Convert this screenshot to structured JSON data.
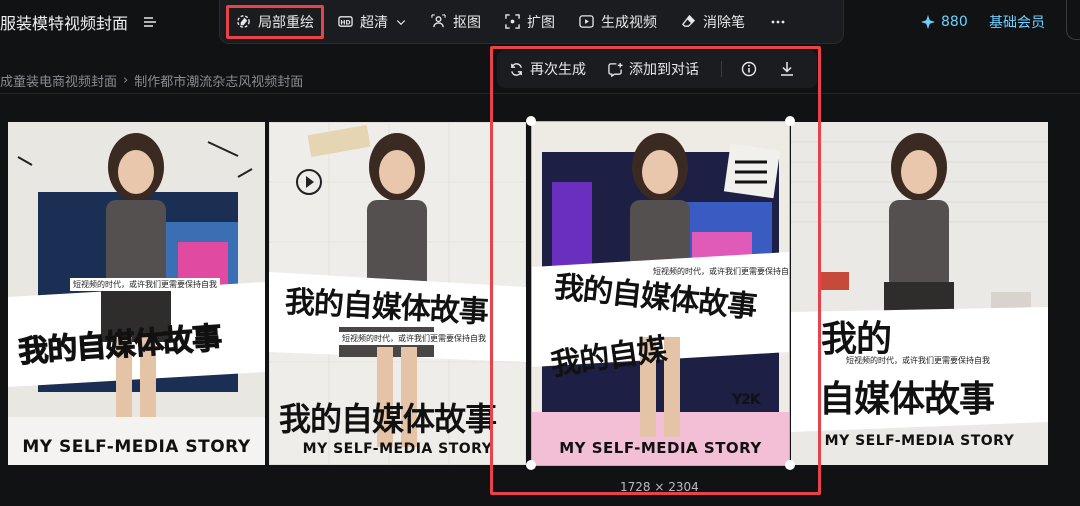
{
  "header": {
    "title": "服装模特视频封面",
    "credits": "880",
    "member": "基础会员"
  },
  "toolbar": {
    "items": [
      {
        "label": "局部重绘",
        "icon": "inpaint-brush-icon"
      },
      {
        "label": "超清",
        "icon": "hd-icon"
      },
      {
        "label": "抠图",
        "icon": "cutout-person-icon"
      },
      {
        "label": "扩图",
        "icon": "expand-icon"
      },
      {
        "label": "生成视频",
        "icon": "video-play-icon"
      },
      {
        "label": "消除笔",
        "icon": "eraser-icon"
      }
    ]
  },
  "breadcrumb": {
    "items": [
      "成童装电商视频封面",
      "制作都市潮流杂志风视频封面"
    ],
    "separator": "›"
  },
  "actbar": {
    "regenerate": "再次生成",
    "add_to_chat": "添加到对话"
  },
  "canvas": {
    "resolution": "1728 × 2304"
  },
  "posters": [
    {
      "title_top": "我的自媒体故事",
      "subtitle": "短视频的时代，或许我们更需要保持自我",
      "caption": "MY SELF-MEDIA STORY"
    },
    {
      "title_top": "我的自媒体故事",
      "subtitle": "短视频的时代，或许我们更需要保持自我",
      "caption": "MY SELF-MEDIA STORY"
    },
    {
      "title_top": "我的自媒",
      "title_mid": "我的自媒体故事",
      "subtitle": "短视频的时代，或许我们更需要保持自我",
      "caption": "MY SELF-MEDIA STORY",
      "tag": "Y2K"
    },
    {
      "title_top": "我的",
      "title_mid": "自媒体故事",
      "subtitle": "短视频的时代，或许我们更需要保持自我",
      "caption": "MY SELF-MEDIA STORY"
    }
  ],
  "colors": {
    "accent_red": "#e8424a",
    "link_blue": "#6fd0ff",
    "selection_blue": "#74c6ff"
  }
}
